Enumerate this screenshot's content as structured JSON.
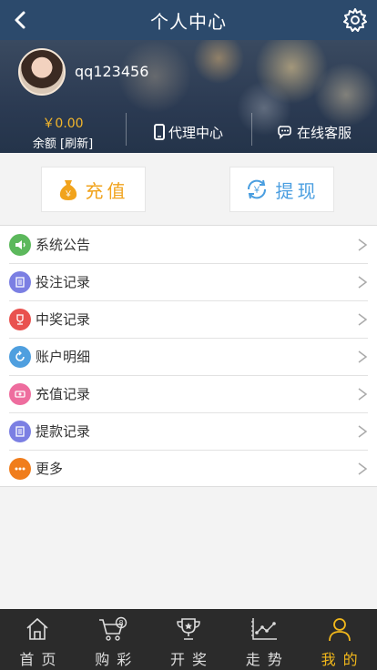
{
  "header": {
    "title": "个人中心",
    "back_icon": "chevron-left-icon",
    "settings_icon": "gear-icon"
  },
  "profile": {
    "username": "qq123456",
    "balance_amount": "￥0.00",
    "balance_label": "余额 [刷新]",
    "agent_center": "代理中心",
    "online_service": "在线客服"
  },
  "actions": {
    "recharge": "充值",
    "withdraw": "提现"
  },
  "menu": {
    "items": [
      {
        "label": "系统公告",
        "icon": "megaphone-icon",
        "color": "#5cb85c"
      },
      {
        "label": "投注记录",
        "icon": "notepad-icon",
        "color": "#7b7fe3"
      },
      {
        "label": "中奖记录",
        "icon": "trophy-icon",
        "color": "#e9524f"
      },
      {
        "label": "账户明细",
        "icon": "refresh-icon",
        "color": "#4f9fdf"
      },
      {
        "label": "充值记录",
        "icon": "cash-icon",
        "color": "#ee6d9e"
      },
      {
        "label": "提款记录",
        "icon": "notepad-icon",
        "color": "#7b7fe3"
      },
      {
        "label": "更多",
        "icon": "more-icon",
        "color": "#f07d1c"
      }
    ]
  },
  "tabbar": {
    "tabs": [
      {
        "label": "首页",
        "icon": "home-icon"
      },
      {
        "label": "购彩",
        "icon": "cart-icon"
      },
      {
        "label": "开奖",
        "icon": "trophy-icon"
      },
      {
        "label": "走势",
        "icon": "trend-icon"
      },
      {
        "label": "我的",
        "icon": "user-icon"
      }
    ],
    "active_index": 4,
    "active_color": "#f2b81b"
  }
}
